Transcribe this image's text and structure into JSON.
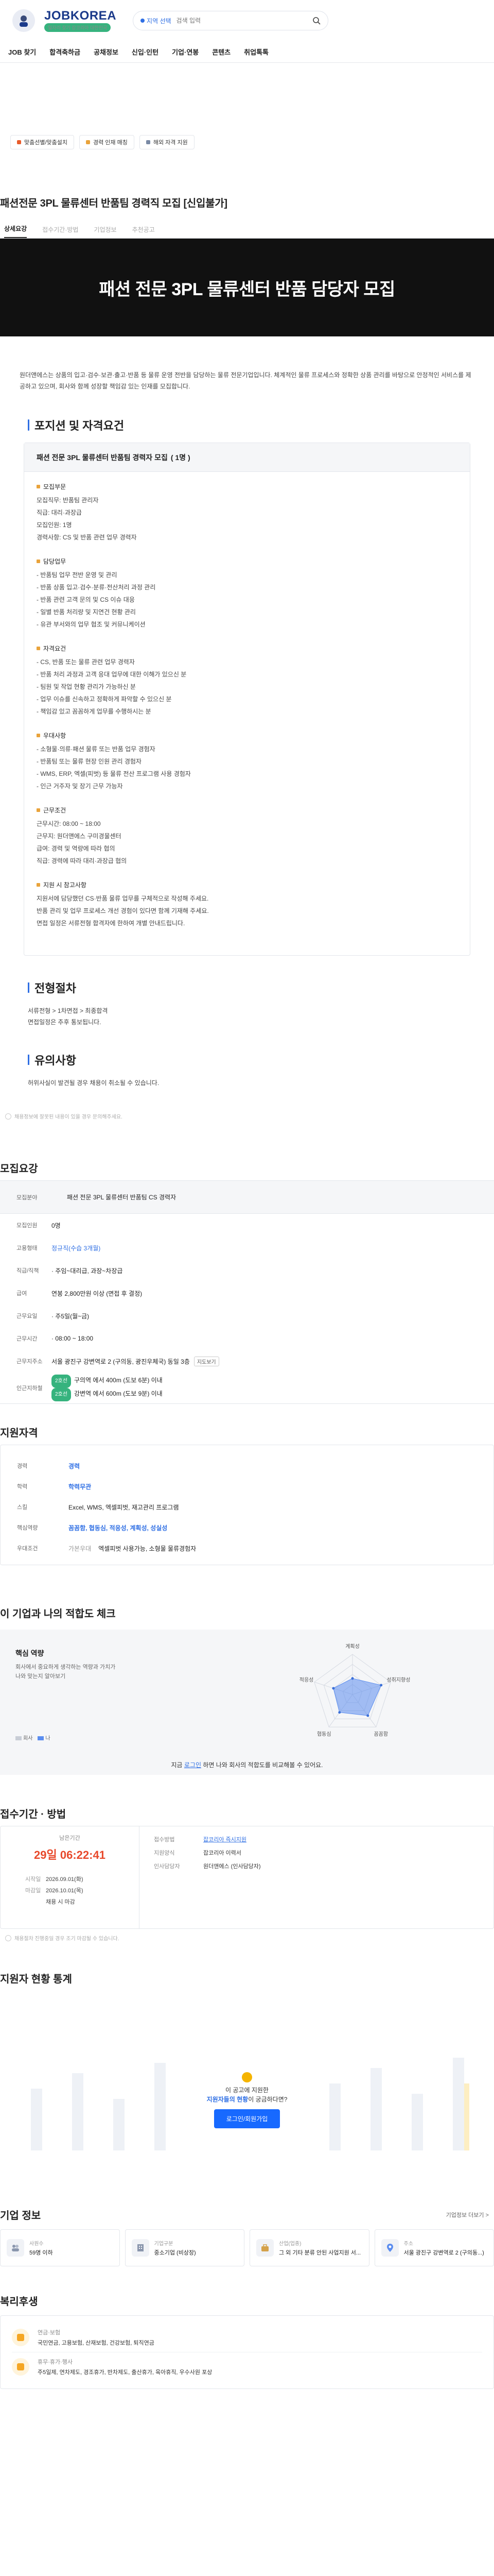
{
  "header": {
    "brand": "JOBKOREA",
    "tagline": "일자리 찾기 잡코리아 대한민국",
    "region_label": "지역 선택",
    "search_placeholder": "검색 입력"
  },
  "nav": [
    "JOB 찾기",
    "합격축하금",
    "공채정보",
    "신입·인턴",
    "기업·연봉",
    "콘텐츠",
    "취업톡톡"
  ],
  "chips": [
    "맞춤선별/맞춤설치",
    "경력 인재 매칭",
    "해외 자격 지원"
  ],
  "job": {
    "title": "패션전문 3PL 물류센터 반품팀 경력직 모집 [신입불가]",
    "tabs": [
      "상세요강",
      "접수기간·방법",
      "기업정보",
      "추천공고"
    ],
    "banner": "패션 전문 3PL 물류센터 반품 담당자 모집",
    "intro": "원더앤에스는 상품의 입고·검수·보관·출고·반품 등 물류 운영 전반을 담당하는 물류 전문기업입니다. 체계적인 물류 프로세스와 정확한 상품 관리를 바탕으로 안정적인 서비스를 제공하고 있으며, 회사와 함께 성장할 책임감 있는 인재를 모집합니다."
  },
  "position": {
    "heading": "포지션 및 자격요건",
    "box_title": "패션 전문 3PL 물류센터 반품팀 경력자 모집",
    "box_count": "( 1명 )",
    "groups": [
      {
        "title": "모집부문",
        "lines": [
          "모집직무: 반품팀 관리자",
          "직급: 대리·과장급",
          "모집인원: 1명",
          "경력사항: CS 및 반품 관련 업무 경력자"
        ]
      },
      {
        "title": "담당업무",
        "lines": [
          "- 반품팀 업무 전반 운영 및 관리",
          "- 반품 상품 입고·검수·분류·전산처리 과정 관리",
          "- 반품 관련 고객 문의 및 CS 이슈 대응",
          "- 일별 반품 처리량 및 지연건 현황 관리",
          "- 유관 부서와의 업무 협조 및 커뮤니케이션"
        ]
      },
      {
        "title": "자격요건",
        "lines": [
          "- CS, 반품 또는 물류 관련 업무 경력자",
          "- 반품 처리 과정과 고객 응대 업무에 대한 이해가 있으신 분",
          "- 팀원 및 작업 현황 관리가 가능하신 분",
          "- 업무 이슈를 신속하고 정확하게 파악할 수 있으신 분",
          "- 책임감 있고 꼼꼼하게 업무를 수행하시는 분"
        ]
      },
      {
        "title": "우대사항",
        "lines": [
          "- 소형물·의류·패션 물류 또는 반품 업무 경험자",
          "- 반품팀 또는 물류 현장 인원 관리 경험자",
          "- WMS, ERP, 엑셀(피벗) 등 물류 전산 프로그램 사용 경험자",
          "- 인근 거주자 및 장기 근무 가능자"
        ]
      },
      {
        "title": "근무조건",
        "lines": [
          "근무시간: 08:00 ~ 18:00",
          "근무지: 원더앤에스 구미경물센터",
          "급여: 경력 및 역량에 따라 협의",
          "직급: 경력에 따라 대리·과장급 협의"
        ]
      },
      {
        "title": "지원 시 참고사항",
        "lines": [
          "지원서에 담당했던 CS·반품 물류 업무를 구체적으로 작성해 주세요.",
          "반품 관리 및 업무 프로세스 개선 경험이 있다면 함께 기재해 주세요.",
          "면접 일정은 서류전형 합격자에 한하여 개별 안내드립니다."
        ]
      }
    ]
  },
  "process": {
    "heading": "전형절차",
    "steps": "서류전형 > 1차면접 > 최종합격",
    "note": "면접일정은 추후 통보됩니다."
  },
  "caution": {
    "heading": "유의사항",
    "text": "허위사실이 발견될 경우 채용이 취소될 수 있습니다."
  },
  "report_note": "채용정보에 잘못된 내용이 있을 경우 문의해주세요.",
  "summary": {
    "heading": "모집요강",
    "head_key": "모집분야",
    "head_val": "패션 전문 3PL 물류센터 반품팀 CS 경력자",
    "rows": [
      {
        "k": "모집인원",
        "v": "0명"
      },
      {
        "k": "고용형태",
        "v": "정규직(수습 3개월)"
      },
      {
        "k": "직급/직책",
        "v": "· 주임~대리급, 과장~차장급"
      },
      {
        "k": "급여",
        "v": "연봉 2,800만원 이상 (면접 후 결정)"
      },
      {
        "k": "근무요일",
        "v": "· 주5일(월~금)"
      },
      {
        "k": "근무시간",
        "v": "· 08:00 ~ 18:00"
      },
      {
        "k": "근무지주소",
        "v": "서울 광진구 강변역로 2 (구의동, 광진우체국) 동일 3층",
        "btn": "지도보기"
      }
    ],
    "commute_key": "인근지하철",
    "commute": [
      {
        "tag": "2호선",
        "text": "구의역 에서 400m (도보 6분) 이내"
      },
      {
        "tag": "2호선",
        "text": "강변역 에서 600m (도보 9분) 이내"
      }
    ]
  },
  "qualification": {
    "heading": "지원자격",
    "rows": [
      {
        "k": "경력",
        "v": "경력"
      },
      {
        "k": "학력",
        "v": "학력무관"
      },
      {
        "k": "스킬",
        "v": "Excel, WMS, 엑셀피벗, 재고관리 프로그램"
      },
      {
        "k": "핵심역량",
        "v": "꼼꼼함, 협동심, 적응성, 계획성, 성실성"
      },
      {
        "k": "우대조건",
        "v_sub": "가본우대",
        "v": "엑셀피벗 사용가능, 소형물 물류경험자"
      }
    ]
  },
  "fit": {
    "heading": "이 기업과 나의 적합도 체크",
    "title": "핵심 역량",
    "desc1": "회사에서 중요하게 생각하는 역량과 가치가",
    "desc2": "나와 맞는지 알아보기",
    "legend_company": "회사",
    "legend_me": "나",
    "axes": [
      "계획성",
      "성취지향성",
      "꼼꼼함",
      "협동심",
      "적응성"
    ],
    "company_values": [
      0.4,
      0.75,
      0.65,
      0.55,
      0.5
    ],
    "cta_pre": "지금",
    "cta_link": "로그인",
    "cta_post": "하면 나와 회사의 적합도를 비교해볼 수 있어요."
  },
  "apply": {
    "heading": "접수기간 · 방법",
    "remain_label": "남은기간",
    "countdown": "29일 06:22:41",
    "start_label": "시작일",
    "start": "2026.09.01(화)",
    "end_label": "마감일",
    "end": "2026.10.01(목)",
    "end_time": "채용 시 마감",
    "rows": [
      {
        "k": "접수방법",
        "v": "잡코리아 즉시지원",
        "link": true
      },
      {
        "k": "지원양식",
        "v": "잡코리아 이력서"
      },
      {
        "k": "인사담당자",
        "v": "원더앤에스 (인사담당자)"
      }
    ],
    "note": "채용절차 진행중일 경우 조기 마감될 수 있습니다."
  },
  "stats": {
    "heading": "지원자 현황 통계",
    "msg1": "이 공고에 지원한",
    "msg2_hl": "지원자들의 현황",
    "msg2_post": "이 궁금하다면?",
    "btn": "로그인/회원가입"
  },
  "company": {
    "heading": "기업 정보",
    "more": "기업정보 더보기 >",
    "cards": [
      {
        "label": "사원수",
        "value": "59명 이하"
      },
      {
        "label": "기업구분",
        "value": "중소기업 (비상장)"
      },
      {
        "label": "산업(업종)",
        "value": "그 외 기타 분류 안된 사업지원 서..."
      },
      {
        "label": "주소",
        "value": "서울 광진구 강변역로 2 (구의동...)"
      }
    ]
  },
  "welfare": {
    "heading": "복리후생",
    "rows": [
      {
        "t": "연금·보험",
        "d": "국민연금, 고용보험, 산재보험, 건강보험, 퇴직연금"
      },
      {
        "t": "휴무·휴가·행사",
        "d": "주5일제, 연차제도, 경조휴가, 반차제도, 출산휴가, 육아휴직, 우수사원 포상"
      }
    ]
  }
}
